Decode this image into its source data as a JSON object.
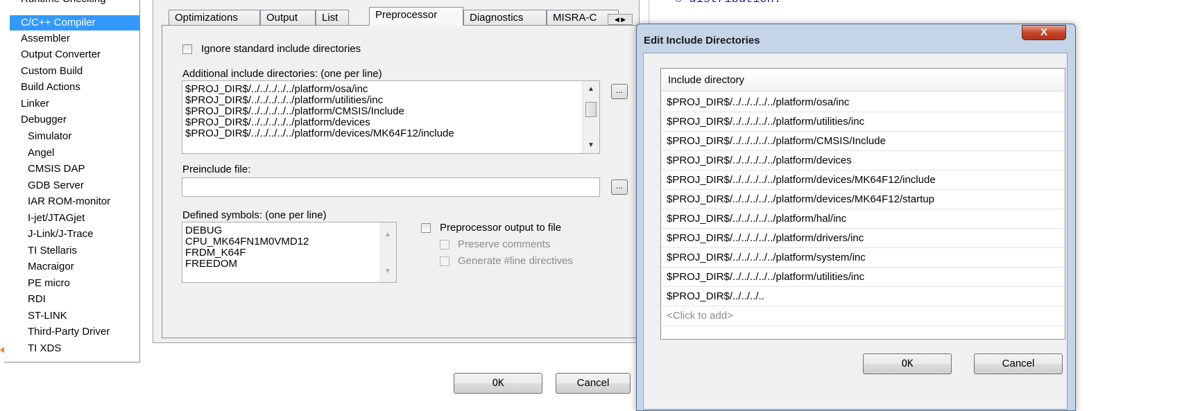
{
  "categories": {
    "clipped_top": "Runtime Checking",
    "selected": "C/C++ Compiler",
    "items": [
      "Assembler",
      "Output Converter",
      "Custom Build",
      "Build Actions",
      "Linker",
      "Debugger"
    ],
    "debugger_children": [
      "Simulator",
      "Angel",
      "CMSIS DAP",
      "GDB Server",
      "IAR ROM-monitor",
      "I-jet/JTAGjet",
      "J-Link/J-Trace",
      "TI Stellaris",
      "Macraigor",
      "PE micro",
      "RDI",
      "ST-LINK",
      "Third-Party Driver",
      "TI XDS"
    ]
  },
  "tabs": [
    "Optimizations",
    "Output",
    "List",
    "Preprocessor",
    "Diagnostics",
    "MISRA-C"
  ],
  "preprocessor": {
    "ignore_std_label": "Ignore standard include directories",
    "additional_label": "Additional include directories: (one per line)",
    "additional_lines": [
      "$PROJ_DIR$/../../../../../platform/osa/inc",
      "$PROJ_DIR$/../../../../../platform/utilities/inc",
      "$PROJ_DIR$/../../../../../platform/CMSIS/Include",
      "$PROJ_DIR$/../../../../../platform/devices",
      "$PROJ_DIR$/../../../../../platform/devices/MK64F12/include"
    ],
    "browse_label": "...",
    "preinclude_label": "Preinclude file:",
    "preinclude_value": "",
    "defined_label": "Defined symbols: (one per line)",
    "defined_lines": [
      "DEBUG",
      "CPU_MK64FN1M0VMD12",
      "FRDM_K64F",
      "FREEDOM"
    ],
    "output_to_file_label": "Preprocessor output to file",
    "preserve_comments_label": "Preserve comments",
    "generate_line_label": "Generate #line directives"
  },
  "main_buttons": {
    "ok": "OK",
    "cancel": "Cancel"
  },
  "editor_text": "© distribution.",
  "dialog": {
    "title": "Edit Include Directories",
    "close": "X",
    "column_header": "Include directory",
    "rows": [
      "$PROJ_DIR$/../../../../../platform/osa/inc",
      "$PROJ_DIR$/../../../../../platform/utilities/inc",
      "$PROJ_DIR$/../../../../../platform/CMSIS/Include",
      "$PROJ_DIR$/../../../../../platform/devices",
      "$PROJ_DIR$/../../../../../platform/devices/MK64F12/include",
      "$PROJ_DIR$/../../../../../platform/devices/MK64F12/startup",
      "$PROJ_DIR$/../../../../../platform/hal/inc",
      "$PROJ_DIR$/../../../../../platform/drivers/inc",
      "$PROJ_DIR$/../../../../../platform/system/inc",
      "$PROJ_DIR$/../../../../../platform/utilities/inc",
      "$PROJ_DIR$/../../../.."
    ],
    "add_placeholder": "<Click to add>",
    "ok": "OK",
    "cancel": "Cancel"
  },
  "colors": {
    "selection": "#3399ff",
    "marker": "#f08a2b"
  }
}
